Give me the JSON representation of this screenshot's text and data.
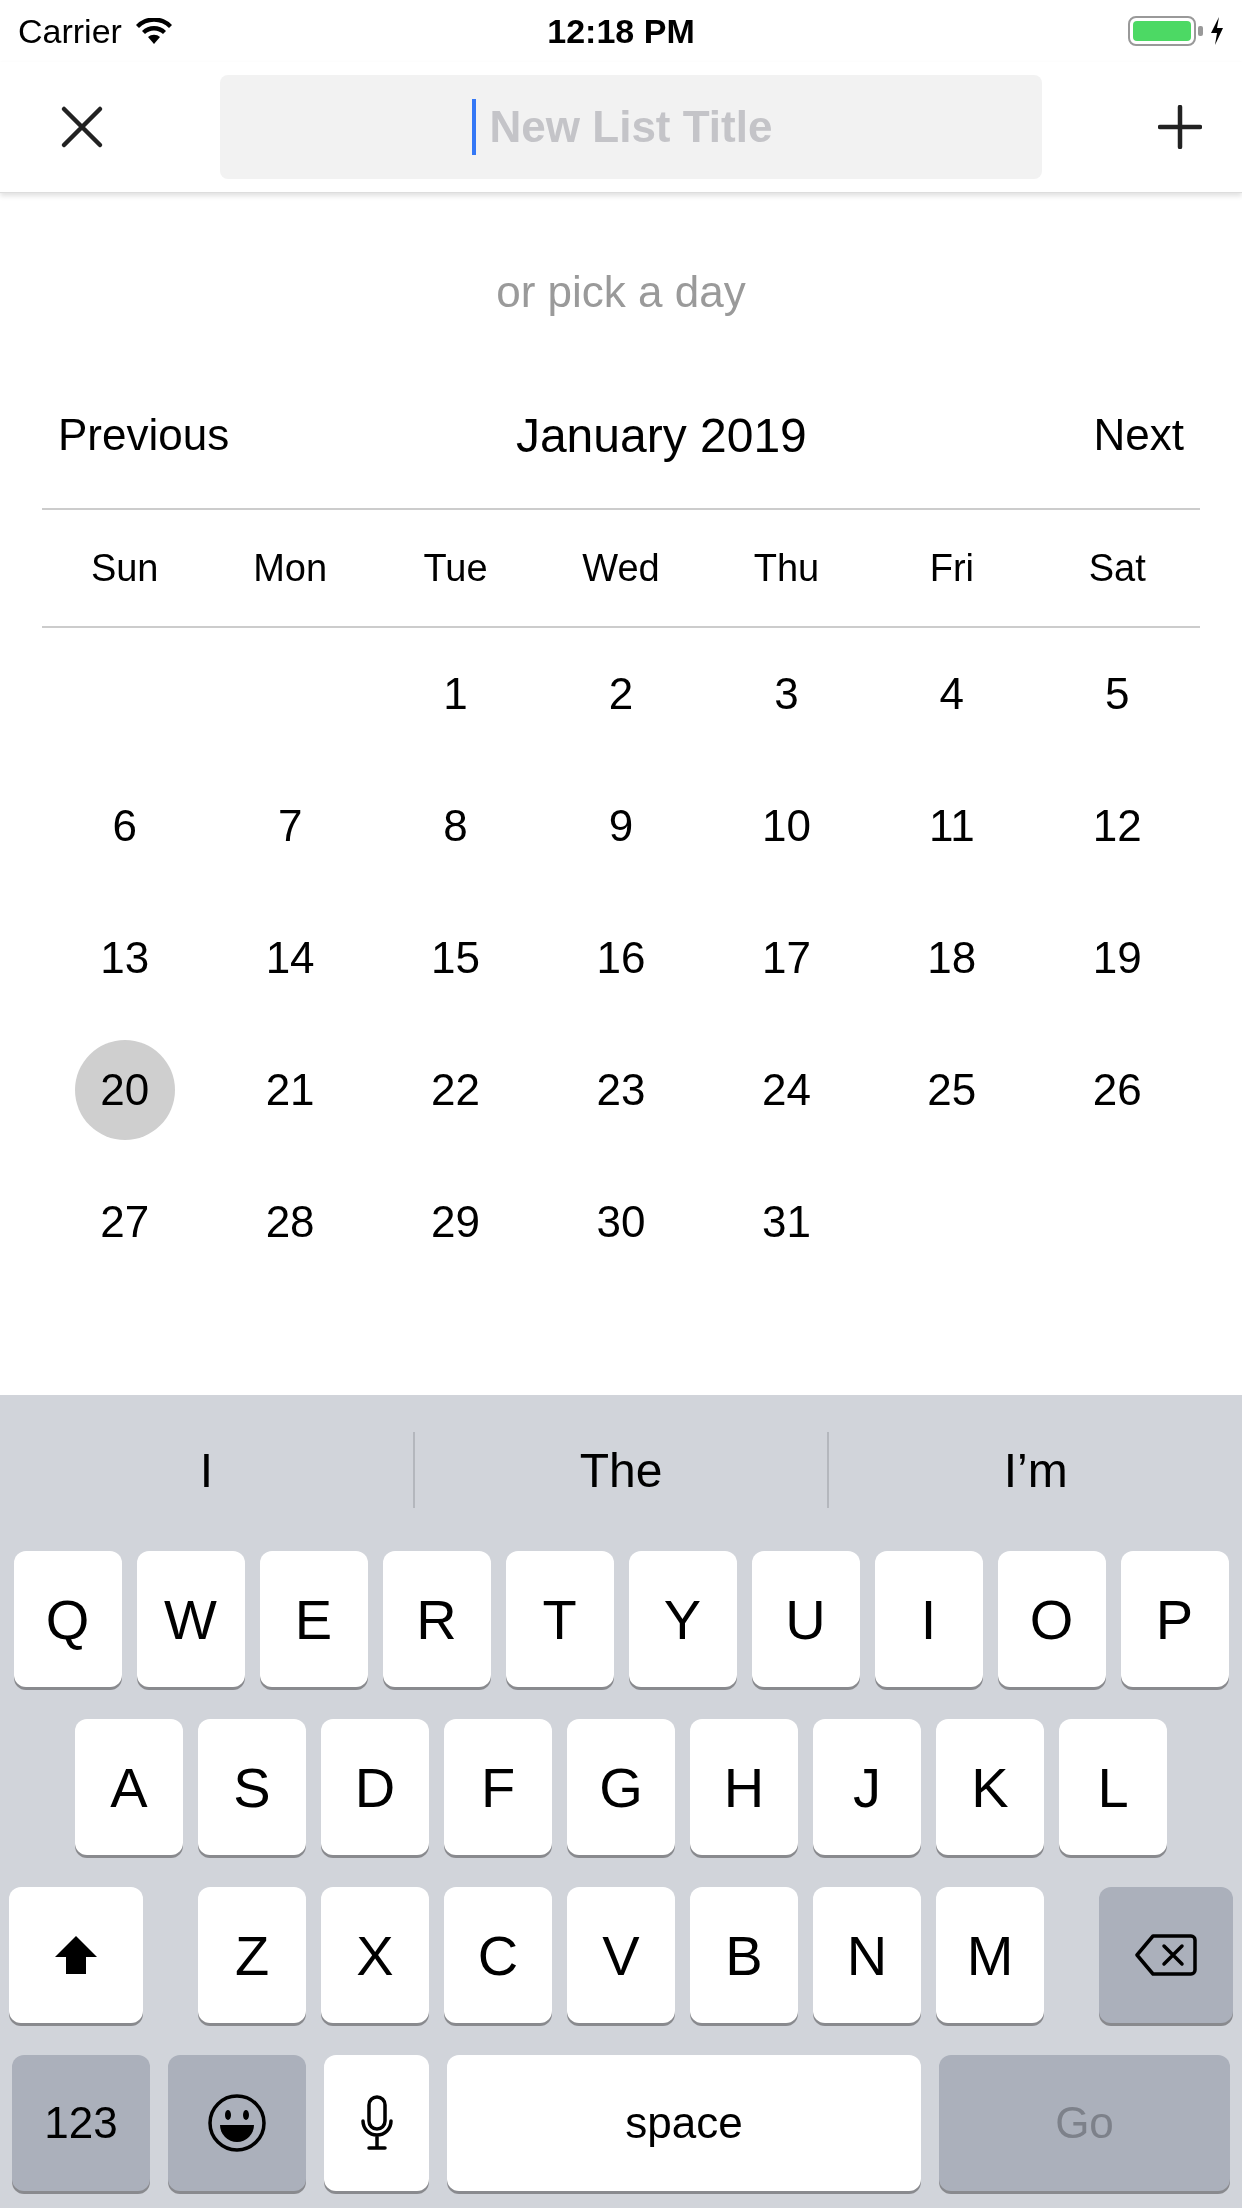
{
  "status_bar": {
    "carrier": "Carrier",
    "time": "12:18 PM"
  },
  "nav_bar": {
    "title_field": {
      "placeholder": "New List Title"
    }
  },
  "hint": "or pick a day",
  "calendar": {
    "previous": "Previous",
    "month": "January 2019",
    "next": "Next",
    "weekdays": [
      "Sun",
      "Mon",
      "Tue",
      "Wed",
      "Thu",
      "Fri",
      "Sat"
    ],
    "weeks": [
      [
        {
          "day": "1",
          "selected": false
        },
        {
          "day": "2",
          "selected": false
        },
        {
          "day": "3",
          "selected": false
        },
        {
          "day": "4",
          "selected": false
        },
        {
          "day": "5",
          "selected": false
        }
      ],
      [
        {
          "day": "6",
          "selected": false
        },
        {
          "day": "7",
          "selected": false
        },
        {
          "day": "8",
          "selected": false
        },
        {
          "day": "9",
          "selected": false
        },
        {
          "day": "10",
          "selected": false
        },
        {
          "day": "11",
          "selected": false
        },
        {
          "day": "12",
          "selected": false
        }
      ],
      [
        {
          "day": "13",
          "selected": false
        },
        {
          "day": "14",
          "selected": false
        },
        {
          "day": "15",
          "selected": false
        },
        {
          "day": "16",
          "selected": false
        },
        {
          "day": "17",
          "selected": false
        },
        {
          "day": "18",
          "selected": false
        },
        {
          "day": "19",
          "selected": false
        }
      ],
      [
        {
          "day": "20",
          "selected": true
        },
        {
          "day": "21",
          "selected": false
        },
        {
          "day": "22",
          "selected": false
        },
        {
          "day": "23",
          "selected": false
        },
        {
          "day": "24",
          "selected": false
        },
        {
          "day": "25",
          "selected": false
        },
        {
          "day": "26",
          "selected": false
        }
      ],
      [
        {
          "day": "27",
          "selected": false
        },
        {
          "day": "28",
          "selected": false
        },
        {
          "day": "29",
          "selected": false
        },
        {
          "day": "30",
          "selected": false
        },
        {
          "day": "31",
          "selected": false
        }
      ]
    ]
  },
  "keyboard": {
    "suggestions": [
      "I",
      "The",
      "I’m"
    ],
    "rows": [
      [
        {
          "kind": "letter",
          "label": "Q"
        },
        {
          "kind": "letter",
          "label": "W"
        },
        {
          "kind": "letter",
          "label": "E"
        },
        {
          "kind": "letter",
          "label": "R"
        },
        {
          "kind": "letter",
          "label": "T"
        },
        {
          "kind": "letter",
          "label": "Y"
        },
        {
          "kind": "letter",
          "label": "U"
        },
        {
          "kind": "letter",
          "label": "I"
        },
        {
          "kind": "letter",
          "label": "O"
        },
        {
          "kind": "letter",
          "label": "P"
        }
      ],
      [
        {
          "kind": "letter",
          "label": "A"
        },
        {
          "kind": "letter",
          "label": "S"
        },
        {
          "kind": "letter",
          "label": "D"
        },
        {
          "kind": "letter",
          "label": "F"
        },
        {
          "kind": "letter",
          "label": "G"
        },
        {
          "kind": "letter",
          "label": "H"
        },
        {
          "kind": "letter",
          "label": "J"
        },
        {
          "kind": "letter",
          "label": "K"
        },
        {
          "kind": "letter",
          "label": "L"
        }
      ],
      [
        {
          "kind": "shift"
        },
        {
          "kind": "letter",
          "label": "Z"
        },
        {
          "kind": "letter",
          "label": "X"
        },
        {
          "kind": "letter",
          "label": "C"
        },
        {
          "kind": "letter",
          "label": "V"
        },
        {
          "kind": "letter",
          "label": "B"
        },
        {
          "kind": "letter",
          "label": "N"
        },
        {
          "kind": "letter",
          "label": "M"
        },
        {
          "kind": "delete"
        }
      ],
      [
        {
          "kind": "numbers",
          "label": "123"
        },
        {
          "kind": "emoji"
        },
        {
          "kind": "mic"
        },
        {
          "kind": "space",
          "label": "space"
        },
        {
          "kind": "go",
          "label": "Go",
          "disabled": true
        }
      ]
    ]
  }
}
